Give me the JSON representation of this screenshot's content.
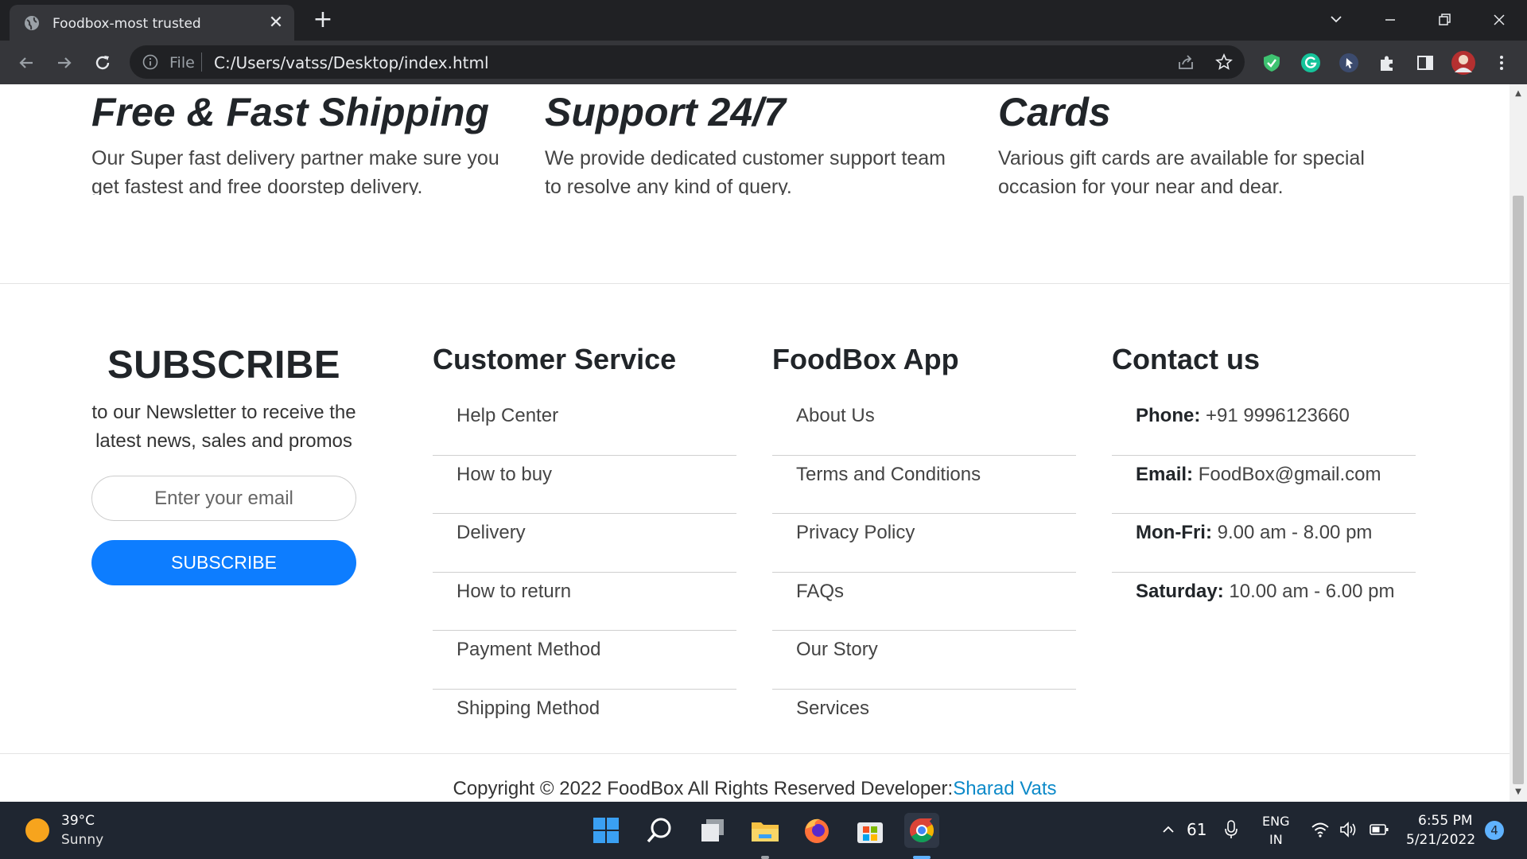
{
  "browser": {
    "tab_title": "Foodbox-most trusted",
    "omnibox_label": "File",
    "url": "C:/Users/vatss/Desktop/index.html"
  },
  "features": [
    {
      "title": "Free & Fast Shipping",
      "text": "Our Super fast delivery partner make sure you get fastest and free doorstep delivery."
    },
    {
      "title": "Support 24/7",
      "text": "We provide dedicated customer support team to resolve any kind of query."
    },
    {
      "title": "Cards",
      "text": "Various gift cards are available for special occasion for your near and dear."
    }
  ],
  "subscribe": {
    "heading": "SUBSCRIBE",
    "text": "to our Newsletter to receive the latest news, sales and promos",
    "email_placeholder": "Enter your email",
    "button_label": "SUBSCRIBE"
  },
  "customer_service": {
    "heading": "Customer Service",
    "items": [
      "Help Center",
      "How to buy",
      "Delivery",
      "How to return",
      "Payment Method",
      "Shipping Method"
    ]
  },
  "foodbox_app": {
    "heading": "FoodBox App",
    "items": [
      "About Us",
      "Terms and Conditions",
      "Privacy Policy",
      "FAQs",
      "Our Story",
      "Services"
    ]
  },
  "contact": {
    "heading": "Contact us",
    "items": [
      {
        "label": "Phone:",
        "value": "+91 9996123660"
      },
      {
        "label": "Email:",
        "value": "FoodBox@gmail.com"
      },
      {
        "label": "Mon-Fri:",
        "value": "9.00 am - 8.00 pm"
      },
      {
        "label": "Saturday:",
        "value": "10.00 am - 6.00 pm"
      }
    ]
  },
  "footer": {
    "copyright": "Copyright © 2022 FoodBox All Rights Reserved Developer:",
    "developer": "Sharad Vats"
  },
  "taskbar": {
    "temperature": "39°C",
    "condition": "Sunny",
    "tray_count": "61",
    "lang_top": "ENG",
    "lang_bottom": "IN",
    "time": "6:55 PM",
    "date": "5/21/2022",
    "notification_count": "4"
  },
  "colors": {
    "accent": "#0d7dff",
    "link": "#0d8ac9",
    "chrome_dark": "#202124",
    "taskbar": "#1f2631"
  }
}
